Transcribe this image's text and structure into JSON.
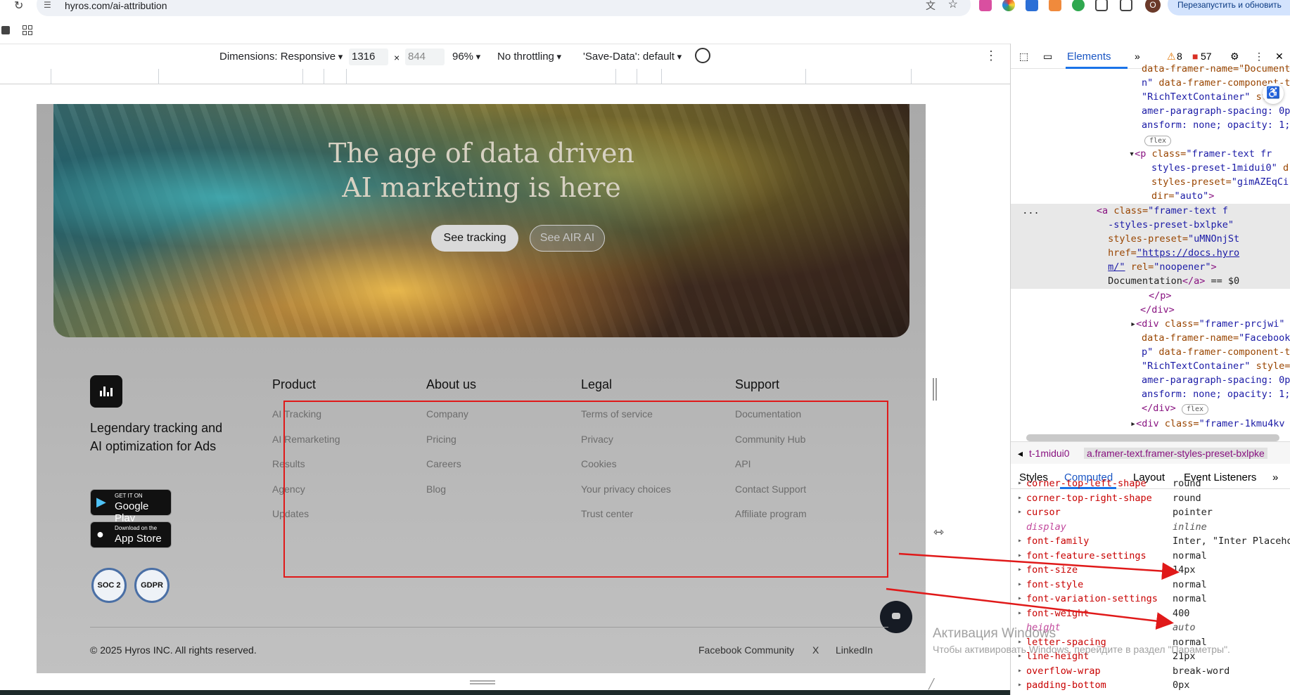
{
  "browser": {
    "url": "hyros.com/ai-attribution",
    "avatar_letter": "O",
    "restart_label": "Перезапустить и обновить"
  },
  "device_toolbar": {
    "dimensions_label": "Dimensions: Responsive",
    "width": "1316",
    "times": "×",
    "height_placeholder": "844",
    "zoom": "96%",
    "throttling": "No throttling",
    "save_data": "'Save-Data': default"
  },
  "page": {
    "hero": {
      "title_line1": "The age of data driven",
      "title_line2": "AI marketing is here",
      "btn_tracking": "See tracking",
      "btn_air": "See AIR AI"
    },
    "tagline": "Legendary tracking and AI optimization for Ads",
    "stores": {
      "google_small": "GET IT ON",
      "google_big": "Google Play",
      "apple_small": "Download on the",
      "apple_big": "App Store"
    },
    "badges": {
      "soc2": "SOC 2",
      "gdpr": "GDPR"
    },
    "columns": [
      {
        "heading": "Product",
        "links": [
          "AI Tracking",
          "AI Remarketing",
          "Results",
          "Agency",
          "Updates"
        ]
      },
      {
        "heading": "About us",
        "links": [
          "Company",
          "Pricing",
          "Careers",
          "Blog"
        ]
      },
      {
        "heading": "Legal",
        "links": [
          "Terms of service",
          "Privacy",
          "Cookies",
          "Your privacy choices",
          "Trust center"
        ]
      },
      {
        "heading": "Support",
        "links": [
          "Documentation",
          "Community Hub",
          "API",
          "Contact Support",
          "Affiliate program"
        ]
      }
    ],
    "copyright": "© 2025 Hyros INC. All rights reserved.",
    "footer_links": [
      "Facebook Community",
      "X",
      "LinkedIn"
    ]
  },
  "watermark": {
    "line1": "Активация Windows",
    "line2": "Чтобы активировать Windows, перейдите в раздел \"Параметры\"."
  },
  "devtools": {
    "tab_elements": "Elements",
    "warnings": "8",
    "errors": "57",
    "breadcrumb_1": "t-1midui0",
    "breadcrumb_2": "a.framer-text.framer-styles-preset-bxlpke",
    "subtabs": [
      "Styles",
      "Computed",
      "Layout",
      "Event Listeners"
    ],
    "computed": [
      {
        "name": "corner-top-left-shape",
        "value": "round",
        "inherited": false
      },
      {
        "name": "corner-top-right-shape",
        "value": "round",
        "inherited": false
      },
      {
        "name": "cursor",
        "value": "pointer",
        "inherited": false
      },
      {
        "name": "display",
        "value": "inline",
        "inherited": true
      },
      {
        "name": "font-family",
        "value": "Inter, \"Inter Placeho",
        "inherited": false
      },
      {
        "name": "font-feature-settings",
        "value": "normal",
        "inherited": false
      },
      {
        "name": "font-size",
        "value": "14px",
        "inherited": false
      },
      {
        "name": "font-style",
        "value": "normal",
        "inherited": false
      },
      {
        "name": "font-variation-settings",
        "value": "normal",
        "inherited": false
      },
      {
        "name": "font-weight",
        "value": "400",
        "inherited": false
      },
      {
        "name": "height",
        "value": "auto",
        "inherited": true
      },
      {
        "name": "letter-spacing",
        "value": "normal",
        "inherited": false
      },
      {
        "name": "line-height",
        "value": "21px",
        "inherited": false
      },
      {
        "name": "overflow-wrap",
        "value": "break-word",
        "inherited": false
      },
      {
        "name": "padding-bottom",
        "value": "0px",
        "inherited": false
      }
    ]
  }
}
